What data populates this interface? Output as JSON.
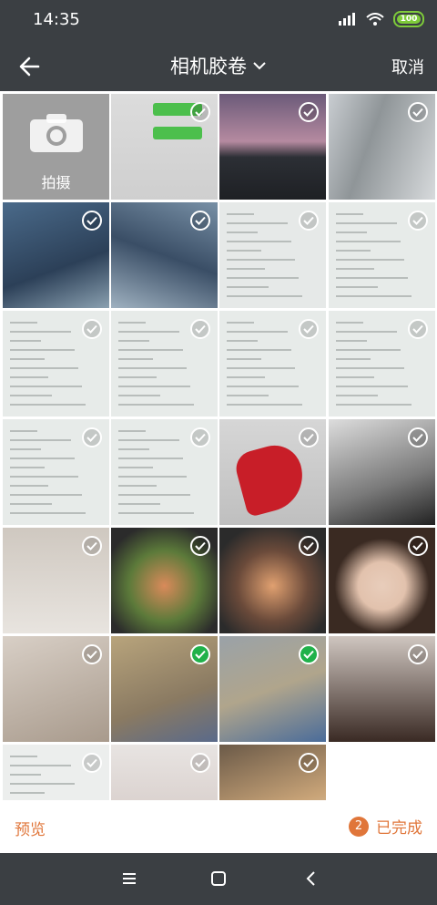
{
  "status": {
    "time": "14:35",
    "battery": "100"
  },
  "header": {
    "title": "相机胶卷",
    "cancel_label": "取消"
  },
  "grid": {
    "camera_label": "拍摄",
    "photos": [
      {
        "name": "chat-screenshot",
        "type": "chat",
        "checked": false
      },
      {
        "name": "city-towers-dusk",
        "type": "city",
        "checked": false
      },
      {
        "name": "room-interior",
        "type": "room",
        "checked": false
      },
      {
        "name": "building-up-1",
        "type": "skyblue",
        "checked": false
      },
      {
        "name": "building-up-2",
        "type": "skyblue2",
        "checked": false
      },
      {
        "name": "form-document",
        "type": "form",
        "checked": false
      },
      {
        "name": "bank-receipt-1",
        "type": "doc",
        "checked": false
      },
      {
        "name": "bank-receipt-2",
        "type": "doc",
        "checked": false
      },
      {
        "name": "bank-receipt-3",
        "type": "doc",
        "checked": false
      },
      {
        "name": "bank-receipt-4",
        "type": "doc",
        "checked": false
      },
      {
        "name": "bank-receipt-5",
        "type": "doc",
        "checked": false
      },
      {
        "name": "transaction-list",
        "type": "doc",
        "checked": false
      },
      {
        "name": "bank-receipt-6",
        "type": "doc",
        "checked": false
      },
      {
        "name": "red-heart-floor",
        "type": "heart",
        "checked": false
      },
      {
        "name": "bouquet-roses",
        "type": "roses",
        "checked": false
      },
      {
        "name": "puppy-floor",
        "type": "puppy",
        "checked": false
      },
      {
        "name": "dish-greens-1",
        "type": "dish",
        "checked": false
      },
      {
        "name": "dish-greens-2",
        "type": "dish2",
        "checked": false
      },
      {
        "name": "selfie-woman",
        "type": "selfie",
        "checked": false
      },
      {
        "name": "puppy-belly",
        "type": "puppy2",
        "checked": false
      },
      {
        "name": "puppy-blanket-1",
        "type": "puppy3",
        "checked": true
      },
      {
        "name": "puppy-blanket-2",
        "type": "puppy4",
        "checked": true
      },
      {
        "name": "child-photo",
        "type": "child",
        "checked": false
      },
      {
        "name": "chat-list",
        "type": "chat2",
        "checked": false
      },
      {
        "name": "puppy-sweater",
        "type": "puppy5",
        "checked": false
      },
      {
        "name": "puppy-lap",
        "type": "puppy6",
        "checked": false
      }
    ]
  },
  "bottom": {
    "preview_label": "预览",
    "count": "2",
    "done_label": "已完成"
  },
  "colors": {
    "accent": "#e0763a",
    "check": "#20b14a",
    "bar": "#3b3f43"
  }
}
